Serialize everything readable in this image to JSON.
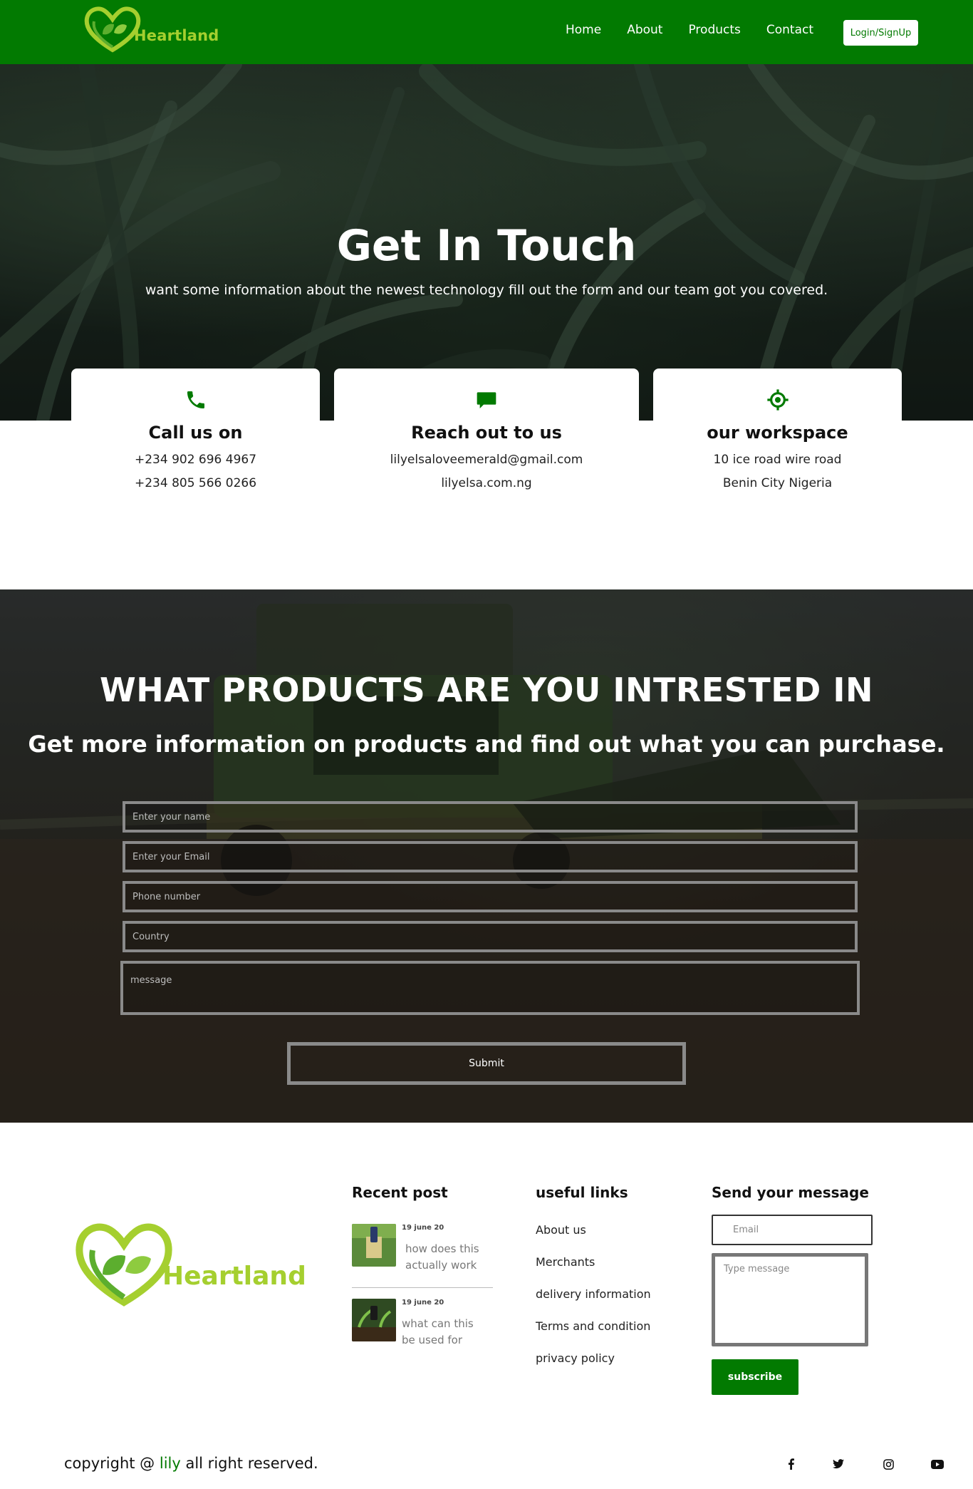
{
  "brand": {
    "name": "Heartland",
    "primary_color": "#027a01",
    "logo_text_color": "#a5cf2f"
  },
  "nav": {
    "items": [
      "Home",
      "About",
      "Products",
      "Contact"
    ],
    "login_label": "Login/SignUp"
  },
  "hero": {
    "title": "Get In Touch",
    "subtitle": "want some information about the newest technology fill out the form and our team got you covered."
  },
  "contact_cards": [
    {
      "icon": "phone-icon",
      "title": "Call us on",
      "lines": [
        "+234 902 696 4967",
        "+234 805 566 0266"
      ]
    },
    {
      "icon": "chat-icon",
      "title": "Reach out to us",
      "lines": [
        "lilyelsaloveemerald@gmail.com",
        "lilyelsa.com.ng"
      ]
    },
    {
      "icon": "location-target-icon",
      "title": "our workspace",
      "lines": [
        "10 ice road wire road",
        "Benin City Nigeria"
      ]
    }
  ],
  "products_form": {
    "title": "WHAT PRODUCTS ARE YOU INTRESTED IN",
    "subtitle": "Get more information on products and find out what you can purchase.",
    "placeholders": {
      "name": "Enter your name",
      "email": "Enter your Email",
      "phone": "Phone number",
      "country": "Country",
      "message": "message"
    },
    "submit_label": "Submit"
  },
  "footer": {
    "recent_post_title": "Recent post",
    "posts": [
      {
        "date": "19 june 20",
        "text": "how does this actually work"
      },
      {
        "date": "19 june 20",
        "text": "what can this be used for"
      }
    ],
    "useful_links_title": "useful links",
    "useful_links": [
      "About us",
      "Merchants",
      "delivery information",
      "Terms and condition",
      "privacy policy"
    ],
    "send_title": "Send your message",
    "email_placeholder": "Email",
    "message_placeholder": "Type message",
    "subscribe_label": "subscribe",
    "copyright_prefix": "copyright @ ",
    "copyright_brand": "lily",
    "copyright_suffix": " all right reserved.",
    "social_icons": [
      "facebook-icon",
      "twitter-icon",
      "instagram-icon",
      "youtube-icon"
    ]
  }
}
